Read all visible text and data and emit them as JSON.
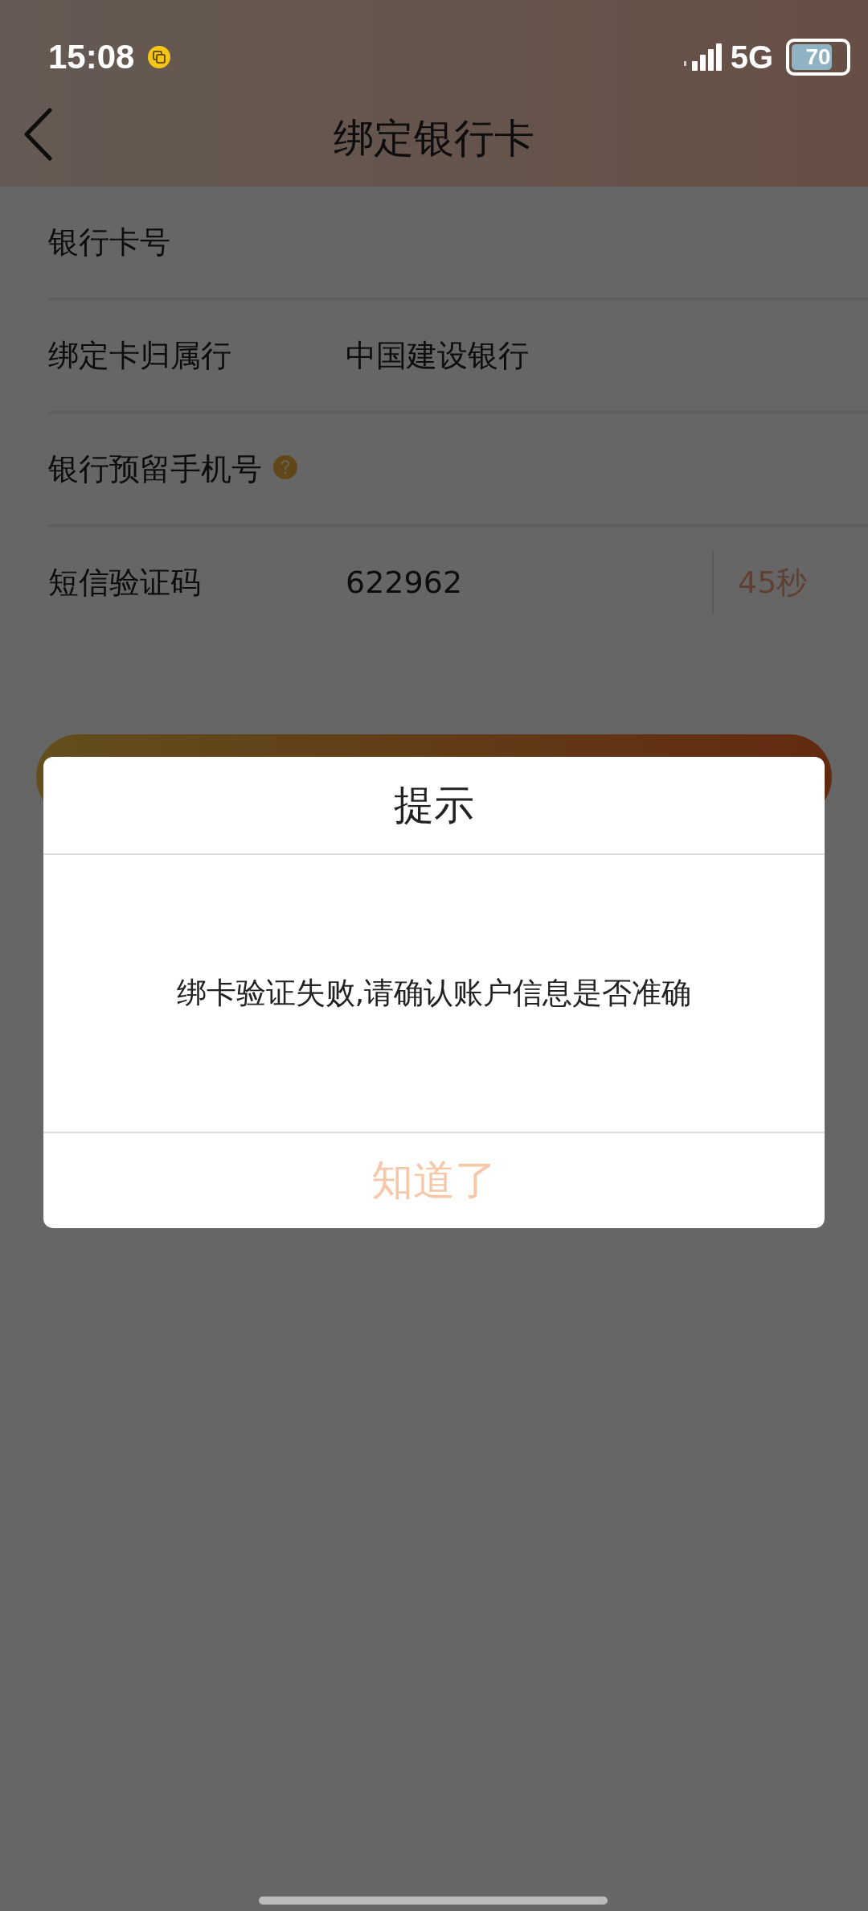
{
  "status_bar": {
    "time": "15:08",
    "network": "5G",
    "battery": "70"
  },
  "header": {
    "title": "绑定银行卡"
  },
  "form": {
    "rows": [
      {
        "kind": "text",
        "label": "银行卡号"
      },
      {
        "kind": "text",
        "label": "绑定卡归属行",
        "value": "中国建设银行"
      },
      {
        "kind": "help",
        "label": "银行预留手机号"
      },
      {
        "kind": "code",
        "label": "短信验证码",
        "value": "622962",
        "countdown": "45秒"
      }
    ]
  },
  "dialog": {
    "title": "提示",
    "message": "绑卡验证失败,请确认账户信息是否准确",
    "button": "知道了"
  }
}
